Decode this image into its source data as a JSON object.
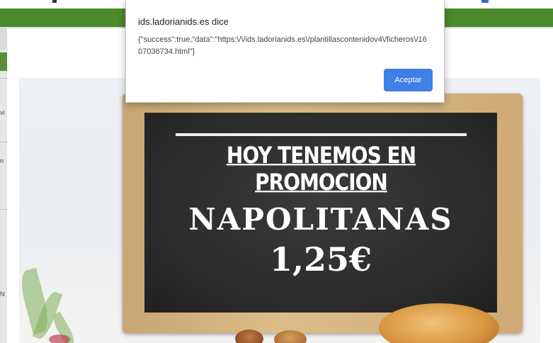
{
  "alert": {
    "title": "ids.ladorianids.es dice",
    "message": "{\"success\":true,\"data\":\"https:\\/\\/ids.ladorianids.es\\/plantillascontenidov4\\/ficheros\\/1607036734.html\"}",
    "accept_label": "Aceptar"
  },
  "promo": {
    "headline": "HOY TENEMOS EN PROMOCION",
    "product": "NAPOLITANAS",
    "price": "1,25€"
  },
  "background_page": {
    "side_fragments": [
      "vi",
      "n",
      "N"
    ]
  },
  "colors": {
    "top_bar_green": "#4a8a2a",
    "accept_button": "#3f7fe6",
    "chalkboard": "#2a2a2a",
    "frame_wood": "#d2ae7a"
  }
}
